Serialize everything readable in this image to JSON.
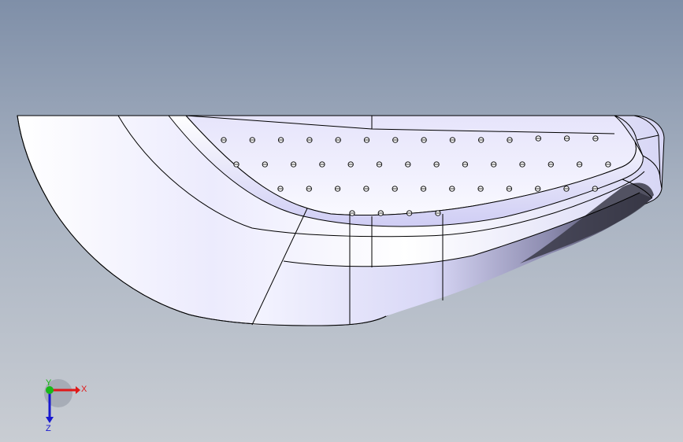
{
  "viewport": {
    "background_top": "#7f8fa8",
    "background_bottom": "#c9cdd3"
  },
  "model": {
    "name": "shell-part-with-perforated-top",
    "face_color_light": "#f2f2ff",
    "face_color_mid": "#c9c8f2",
    "face_color_dark": "#2c2c38",
    "edge_color": "#000000",
    "perforation_rows": [
      {
        "count": 14
      },
      {
        "count": 14
      },
      {
        "count": 12
      },
      {
        "count": 4
      }
    ]
  },
  "triad": {
    "x_label": "X",
    "y_label": "Y",
    "z_label": "Z",
    "x_color": "#e01818",
    "y_color": "#18b818",
    "z_color": "#1818d0"
  }
}
